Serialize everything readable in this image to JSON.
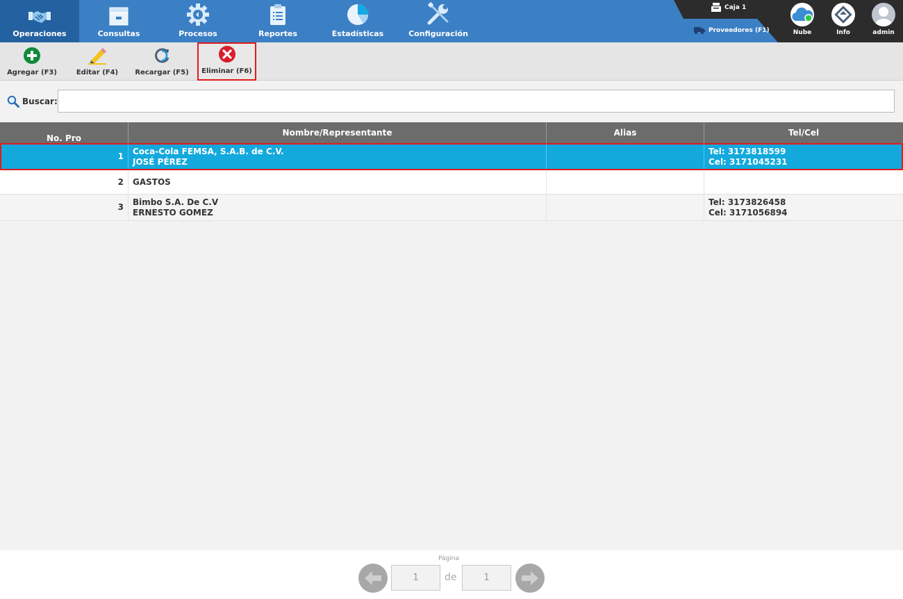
{
  "nav": {
    "items": [
      {
        "label": "Operaciones",
        "icon": "handshake-icon",
        "active": true
      },
      {
        "label": "Consultas",
        "icon": "archive-icon"
      },
      {
        "label": "Procesos",
        "icon": "gear-icon"
      },
      {
        "label": "Reportes",
        "icon": "clipboard-icon"
      },
      {
        "label": "Estadísticas",
        "icon": "pie-chart-icon"
      },
      {
        "label": "Configuración",
        "icon": "wrench-icon"
      }
    ],
    "caja_label": "Caja 1",
    "module_label": "Proveedores (F1)",
    "right_buttons": [
      {
        "label": "Nube",
        "icon": "cloud-icon"
      },
      {
        "label": "Info",
        "icon": "info-icon"
      },
      {
        "label": "admin",
        "icon": "user-icon"
      }
    ]
  },
  "toolbar": {
    "buttons": [
      {
        "label": "Agregar (F3)",
        "icon": "add-icon"
      },
      {
        "label": "Editar (F4)",
        "icon": "pencil-icon"
      },
      {
        "label": "Recargar (F5)",
        "icon": "reload-icon"
      },
      {
        "label": "Eliminar (F6)",
        "icon": "delete-icon",
        "selected": true
      }
    ]
  },
  "search": {
    "label": "Buscar:",
    "value": "",
    "placeholder": ""
  },
  "table": {
    "columns": [
      "No. Pro",
      "Nombre/Representante",
      "Alias",
      "Tel/Cel"
    ],
    "rows": [
      {
        "no": "1",
        "name": "Coca-Cola FEMSA, S.A.B. de C.V.",
        "rep": "JOSÉ PÉREZ",
        "alias": "",
        "tel": "Tel: 3173818599",
        "cel": "Cel: 3171045231",
        "selected": true
      },
      {
        "no": "2",
        "name": "GASTOS",
        "rep": "",
        "alias": "",
        "tel": "",
        "cel": ""
      },
      {
        "no": "3",
        "name": "Bimbo S.A. De C.V",
        "rep": "ERNESTO GOMEZ",
        "alias": "",
        "tel": "Tel: 3173826458",
        "cel": "Cel: 3171056894"
      }
    ]
  },
  "pagination": {
    "label": "Página",
    "current": "1",
    "separator": "de",
    "total": "1"
  },
  "colors": {
    "nav_bg": "#3b7fc4",
    "nav_active": "#2461a0",
    "selected_row": "#13a9dd",
    "highlight_border": "#e01b1b",
    "header_bg": "#6c6c6c"
  }
}
